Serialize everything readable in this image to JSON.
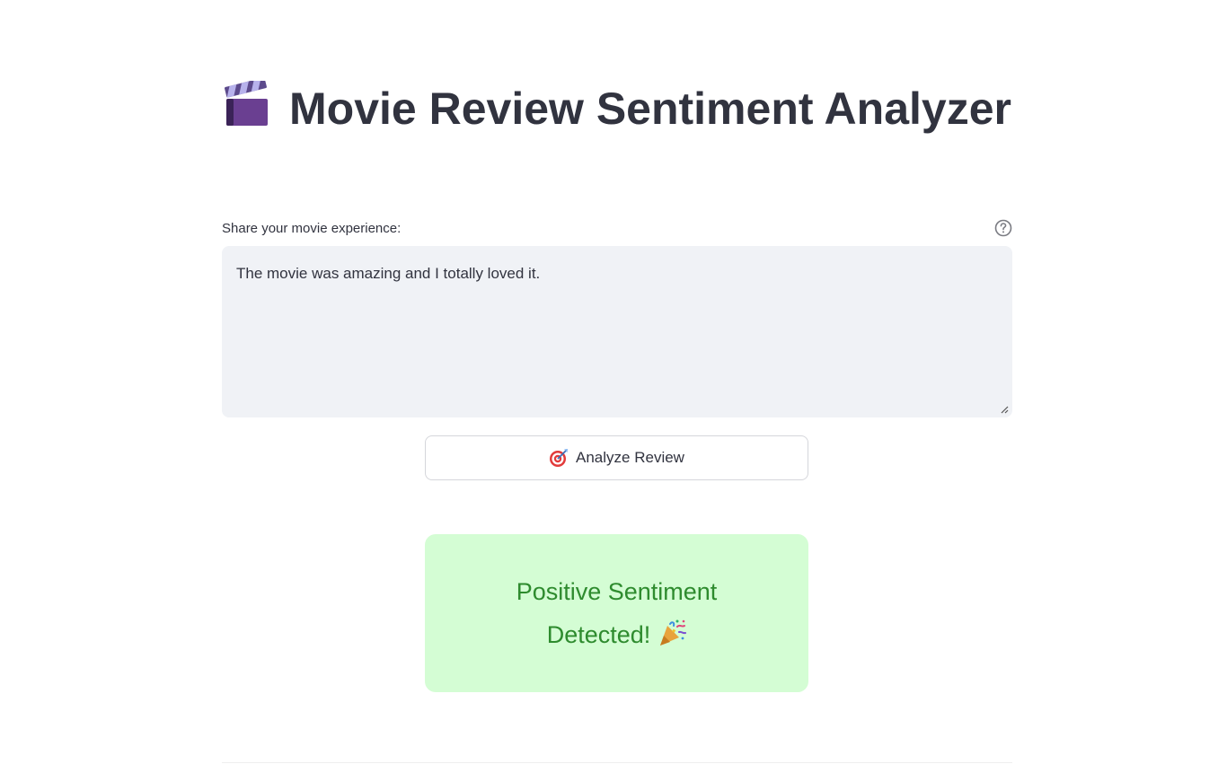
{
  "page": {
    "title": "Movie Review Sentiment Analyzer",
    "title_icon": "clapper-board-icon"
  },
  "review_input": {
    "label": "Share your movie experience:",
    "value": "The movie was amazing and I totally loved it.",
    "help_icon": "help-circle-icon"
  },
  "analyze_button": {
    "label": "Analyze Review",
    "icon": "target-icon"
  },
  "result": {
    "text": "Positive Sentiment Detected!",
    "icon": "party-popper-icon",
    "background_color": "#d4fdd4",
    "text_color": "#2e8b2e"
  }
}
